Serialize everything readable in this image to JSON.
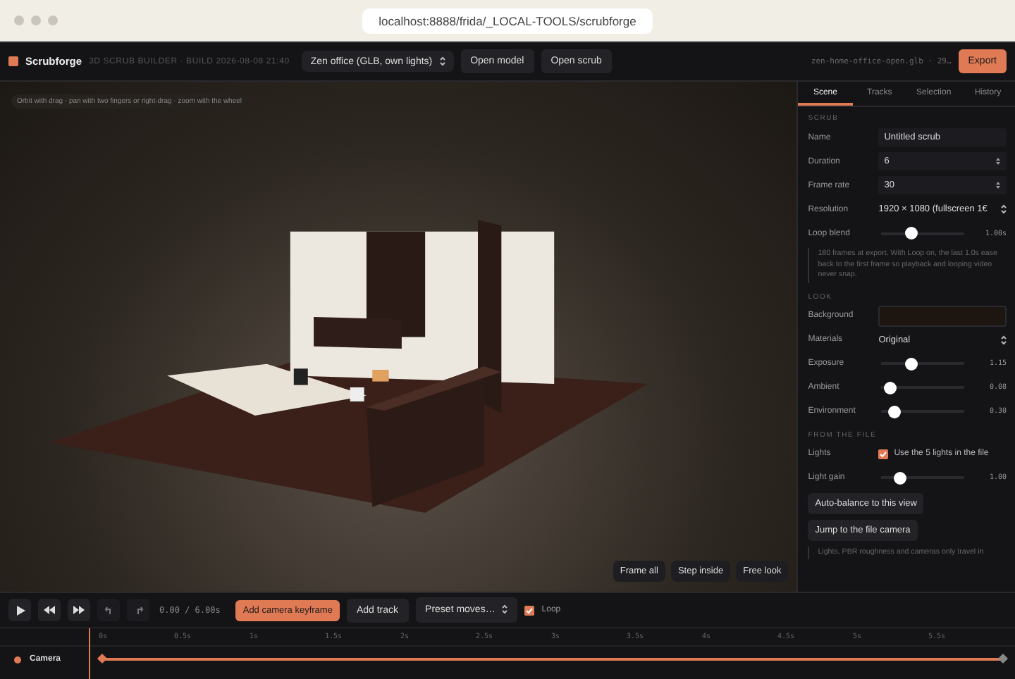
{
  "browser": {
    "url": "localhost:8888/frida/_LOCAL-TOOLS/scrubforge"
  },
  "toolbar": {
    "app_name": "Scrubforge",
    "subtitle": "3D SCRUB BUILDER · BUILD 2026-08-08 21:40",
    "scene_select": "Zen office (GLB, own lights)",
    "buttons": [
      "Open model",
      "Open scrub"
    ],
    "file_info": "zen-home-office-open.glb · 29…",
    "export": "Export"
  },
  "viewport": {
    "hint": "Orbit with drag · pan with two fingers or right-drag · zoom with the wheel",
    "buttons": [
      "Frame all",
      "Step inside",
      "Free look"
    ]
  },
  "panel": {
    "tabs": [
      {
        "label": "Scene",
        "selected": true
      },
      {
        "label": "Tracks",
        "selected": false
      },
      {
        "label": "Selection",
        "selected": false
      },
      {
        "label": "History",
        "selected": false
      }
    ],
    "sections": [
      {
        "title": "SCRUB",
        "rows": [
          {
            "kind": "text",
            "label": "Name",
            "value": "Untitled scrub"
          },
          {
            "kind": "number",
            "label": "Duration",
            "value": "6"
          },
          {
            "kind": "number",
            "label": "Frame rate",
            "value": "30"
          },
          {
            "kind": "select",
            "label": "Resolution",
            "value": "1920 × 1080 (fullscreen 1€"
          },
          {
            "kind": "slider",
            "label": "Loop blend",
            "level": 0.36,
            "reading": "1.00s"
          },
          {
            "kind": "note",
            "text": "180 frames at export. With Loop on, the last 1.0s ease back to the first frame so playback and looping video never snap."
          }
        ]
      },
      {
        "title": "LOOK",
        "rows": [
          {
            "kind": "color",
            "label": "Background",
            "color": "#1c1510"
          },
          {
            "kind": "select",
            "label": "Materials",
            "value": "Original"
          },
          {
            "kind": "slider",
            "label": "Exposure",
            "level": 0.36,
            "reading": "1.15"
          },
          {
            "kind": "slider",
            "label": "Ambient",
            "level": 0.1,
            "reading": "0.08"
          },
          {
            "kind": "slider",
            "label": "Environment",
            "level": 0.16,
            "reading": "0.30"
          }
        ]
      },
      {
        "title": "FROM THE FILE",
        "rows": [
          {
            "kind": "checkbox",
            "label": "Lights",
            "text": "Use the 5 lights in the file",
            "checked": true
          },
          {
            "kind": "slider",
            "label": "Light gain",
            "level": 0.22,
            "reading": "1.00"
          },
          {
            "kind": "button",
            "text": "Auto-balance to this view"
          },
          {
            "kind": "button",
            "text": "Jump to the file camera"
          },
          {
            "kind": "note",
            "text": "Lights, PBR roughness and cameras only travel in"
          }
        ]
      }
    ]
  },
  "transport": {
    "time": "0.00 / 6.00s",
    "add_keyframe": "Add camera keyframe",
    "add_track": "Add track",
    "preset": "Preset moves…",
    "loop": {
      "label": "Loop",
      "checked": true
    }
  },
  "timeline": {
    "ticks": [
      "0s",
      "0.5s",
      "1s",
      "1.5s",
      "2s",
      "2.5s",
      "3s",
      "3.5s",
      "4s",
      "4.5s",
      "5s",
      "5.5s"
    ],
    "tracks": [
      {
        "name": "Camera",
        "color": "#e07a55"
      }
    ]
  }
}
